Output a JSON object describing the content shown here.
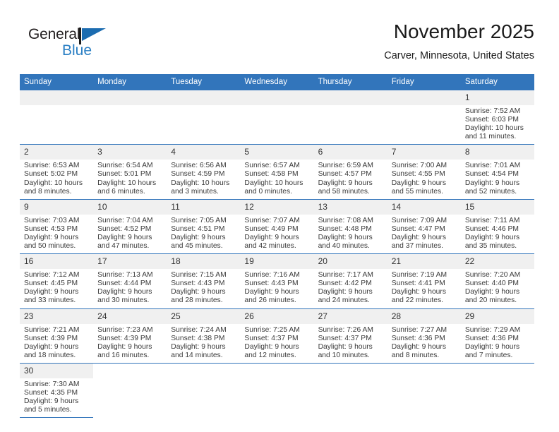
{
  "brand": {
    "word_one": "General",
    "word_two": "Blue",
    "flag_icon": "triangle-flag-icon",
    "accent": "#2a7fc4"
  },
  "header": {
    "title": "November 2025",
    "location": "Carver, Minnesota, United States"
  },
  "theme": {
    "header_blue": "#3275bb",
    "daynum_band": "#f0f0f0",
    "text": "#3a3a3a"
  },
  "calendar": {
    "weekday_headers": [
      "Sunday",
      "Monday",
      "Tuesday",
      "Wednesday",
      "Thursday",
      "Friday",
      "Saturday"
    ],
    "labels": {
      "sunrise": "Sunrise:",
      "sunset": "Sunset:",
      "daylight": "Daylight:"
    },
    "weeks": [
      [
        {
          "day": "",
          "blank": true
        },
        {
          "day": "",
          "blank": true
        },
        {
          "day": "",
          "blank": true
        },
        {
          "day": "",
          "blank": true
        },
        {
          "day": "",
          "blank": true
        },
        {
          "day": "",
          "blank": true
        },
        {
          "day": "1",
          "sunrise": "Sunrise: 7:52 AM",
          "sunset": "Sunset: 6:03 PM",
          "daylight_line1": "Daylight: 10 hours",
          "daylight_line2": "and 11 minutes."
        }
      ],
      [
        {
          "day": "2",
          "sunrise": "Sunrise: 6:53 AM",
          "sunset": "Sunset: 5:02 PM",
          "daylight_line1": "Daylight: 10 hours",
          "daylight_line2": "and 8 minutes."
        },
        {
          "day": "3",
          "sunrise": "Sunrise: 6:54 AM",
          "sunset": "Sunset: 5:01 PM",
          "daylight_line1": "Daylight: 10 hours",
          "daylight_line2": "and 6 minutes."
        },
        {
          "day": "4",
          "sunrise": "Sunrise: 6:56 AM",
          "sunset": "Sunset: 4:59 PM",
          "daylight_line1": "Daylight: 10 hours",
          "daylight_line2": "and 3 minutes."
        },
        {
          "day": "5",
          "sunrise": "Sunrise: 6:57 AM",
          "sunset": "Sunset: 4:58 PM",
          "daylight_line1": "Daylight: 10 hours",
          "daylight_line2": "and 0 minutes."
        },
        {
          "day": "6",
          "sunrise": "Sunrise: 6:59 AM",
          "sunset": "Sunset: 4:57 PM",
          "daylight_line1": "Daylight: 9 hours",
          "daylight_line2": "and 58 minutes."
        },
        {
          "day": "7",
          "sunrise": "Sunrise: 7:00 AM",
          "sunset": "Sunset: 4:55 PM",
          "daylight_line1": "Daylight: 9 hours",
          "daylight_line2": "and 55 minutes."
        },
        {
          "day": "8",
          "sunrise": "Sunrise: 7:01 AM",
          "sunset": "Sunset: 4:54 PM",
          "daylight_line1": "Daylight: 9 hours",
          "daylight_line2": "and 52 minutes."
        }
      ],
      [
        {
          "day": "9",
          "sunrise": "Sunrise: 7:03 AM",
          "sunset": "Sunset: 4:53 PM",
          "daylight_line1": "Daylight: 9 hours",
          "daylight_line2": "and 50 minutes."
        },
        {
          "day": "10",
          "sunrise": "Sunrise: 7:04 AM",
          "sunset": "Sunset: 4:52 PM",
          "daylight_line1": "Daylight: 9 hours",
          "daylight_line2": "and 47 minutes."
        },
        {
          "day": "11",
          "sunrise": "Sunrise: 7:05 AM",
          "sunset": "Sunset: 4:51 PM",
          "daylight_line1": "Daylight: 9 hours",
          "daylight_line2": "and 45 minutes."
        },
        {
          "day": "12",
          "sunrise": "Sunrise: 7:07 AM",
          "sunset": "Sunset: 4:49 PM",
          "daylight_line1": "Daylight: 9 hours",
          "daylight_line2": "and 42 minutes."
        },
        {
          "day": "13",
          "sunrise": "Sunrise: 7:08 AM",
          "sunset": "Sunset: 4:48 PM",
          "daylight_line1": "Daylight: 9 hours",
          "daylight_line2": "and 40 minutes."
        },
        {
          "day": "14",
          "sunrise": "Sunrise: 7:09 AM",
          "sunset": "Sunset: 4:47 PM",
          "daylight_line1": "Daylight: 9 hours",
          "daylight_line2": "and 37 minutes."
        },
        {
          "day": "15",
          "sunrise": "Sunrise: 7:11 AM",
          "sunset": "Sunset: 4:46 PM",
          "daylight_line1": "Daylight: 9 hours",
          "daylight_line2": "and 35 minutes."
        }
      ],
      [
        {
          "day": "16",
          "sunrise": "Sunrise: 7:12 AM",
          "sunset": "Sunset: 4:45 PM",
          "daylight_line1": "Daylight: 9 hours",
          "daylight_line2": "and 33 minutes."
        },
        {
          "day": "17",
          "sunrise": "Sunrise: 7:13 AM",
          "sunset": "Sunset: 4:44 PM",
          "daylight_line1": "Daylight: 9 hours",
          "daylight_line2": "and 30 minutes."
        },
        {
          "day": "18",
          "sunrise": "Sunrise: 7:15 AM",
          "sunset": "Sunset: 4:43 PM",
          "daylight_line1": "Daylight: 9 hours",
          "daylight_line2": "and 28 minutes."
        },
        {
          "day": "19",
          "sunrise": "Sunrise: 7:16 AM",
          "sunset": "Sunset: 4:43 PM",
          "daylight_line1": "Daylight: 9 hours",
          "daylight_line2": "and 26 minutes."
        },
        {
          "day": "20",
          "sunrise": "Sunrise: 7:17 AM",
          "sunset": "Sunset: 4:42 PM",
          "daylight_line1": "Daylight: 9 hours",
          "daylight_line2": "and 24 minutes."
        },
        {
          "day": "21",
          "sunrise": "Sunrise: 7:19 AM",
          "sunset": "Sunset: 4:41 PM",
          "daylight_line1": "Daylight: 9 hours",
          "daylight_line2": "and 22 minutes."
        },
        {
          "day": "22",
          "sunrise": "Sunrise: 7:20 AM",
          "sunset": "Sunset: 4:40 PM",
          "daylight_line1": "Daylight: 9 hours",
          "daylight_line2": "and 20 minutes."
        }
      ],
      [
        {
          "day": "23",
          "sunrise": "Sunrise: 7:21 AM",
          "sunset": "Sunset: 4:39 PM",
          "daylight_line1": "Daylight: 9 hours",
          "daylight_line2": "and 18 minutes."
        },
        {
          "day": "24",
          "sunrise": "Sunrise: 7:23 AM",
          "sunset": "Sunset: 4:39 PM",
          "daylight_line1": "Daylight: 9 hours",
          "daylight_line2": "and 16 minutes."
        },
        {
          "day": "25",
          "sunrise": "Sunrise: 7:24 AM",
          "sunset": "Sunset: 4:38 PM",
          "daylight_line1": "Daylight: 9 hours",
          "daylight_line2": "and 14 minutes."
        },
        {
          "day": "26",
          "sunrise": "Sunrise: 7:25 AM",
          "sunset": "Sunset: 4:37 PM",
          "daylight_line1": "Daylight: 9 hours",
          "daylight_line2": "and 12 minutes."
        },
        {
          "day": "27",
          "sunrise": "Sunrise: 7:26 AM",
          "sunset": "Sunset: 4:37 PM",
          "daylight_line1": "Daylight: 9 hours",
          "daylight_line2": "and 10 minutes."
        },
        {
          "day": "28",
          "sunrise": "Sunrise: 7:27 AM",
          "sunset": "Sunset: 4:36 PM",
          "daylight_line1": "Daylight: 9 hours",
          "daylight_line2": "and 8 minutes."
        },
        {
          "day": "29",
          "sunrise": "Sunrise: 7:29 AM",
          "sunset": "Sunset: 4:36 PM",
          "daylight_line1": "Daylight: 9 hours",
          "daylight_line2": "and 7 minutes."
        }
      ],
      [
        {
          "day": "30",
          "sunrise": "Sunrise: 7:30 AM",
          "sunset": "Sunset: 4:35 PM",
          "daylight_line1": "Daylight: 9 hours",
          "daylight_line2": "and 5 minutes."
        },
        {
          "day": "",
          "blank": true
        },
        {
          "day": "",
          "blank": true
        },
        {
          "day": "",
          "blank": true
        },
        {
          "day": "",
          "blank": true
        },
        {
          "day": "",
          "blank": true
        },
        {
          "day": "",
          "blank": true
        }
      ]
    ]
  }
}
